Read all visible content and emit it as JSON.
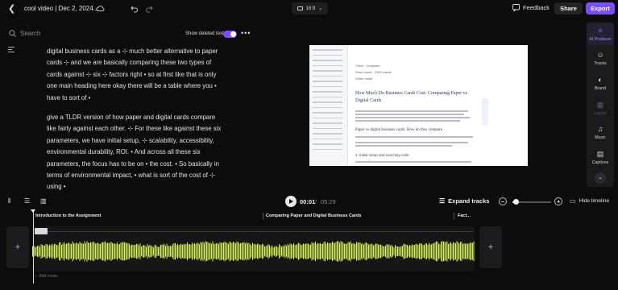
{
  "header": {
    "title": "cool video | Dec 2, 2024...",
    "aspect_ratio": "16:9",
    "feedback_label": "Feedback",
    "share_label": "Share",
    "export_label": "Export",
    "accent_color": "#7c4dff"
  },
  "transcript_panel": {
    "search_placeholder": "Search",
    "show_deleted_label": "Show deleted text",
    "show_deleted_on": true,
    "paragraphs": [
      "digital business cards as a ⊹ much better alternative to paper cards ⊹ and we are basically comparing these two types of cards against ⊹ six ⊹ factors right • so at first like that is only one main heading here okay there will be a table where you • have to sort of •",
      "give a TLDR version of how paper and digital cards compare like fairly against each other. ⊹ For these like against these six parameters, we have initial setup, ⊹ scalability, accessibility, environmental durability, ROI. • And across all these six parameters, the focus has to be on • the cost. • So basically in terms of environmental impact, • what is sort of the cost of ⊹ using •"
    ]
  },
  "preview": {
    "fields": [
      "Client - Unsplash",
      "Word count - 2000 words",
      "Writer email"
    ],
    "heading": "How Much Do Business Cards Cost: Comparing Paper vs Digital Cards",
    "subheading": "Paper vs digital business cards: How do they compare",
    "list_item": "1. Initial setup and sourcing costs"
  },
  "right_rail": {
    "items": [
      {
        "label": "AI Producer",
        "icon": "sparkle-icon"
      },
      {
        "label": "Tracks",
        "icon": "people-icon"
      },
      {
        "label": "Brand",
        "icon": "palette-icon"
      },
      {
        "label": "Layout",
        "icon": "layout-icon"
      },
      {
        "label": "Music",
        "icon": "music-icon"
      },
      {
        "label": "Captions",
        "icon": "captions-icon"
      }
    ]
  },
  "timeline": {
    "current_time": "00:01",
    "separator": "/",
    "total_time": "05:29",
    "expand_label": "Expand tracks",
    "hide_label": "Hide timeline",
    "zoom_level": 0.05,
    "chapters": [
      "Introduction to the Assignment",
      "Comparing Paper and Digital Business Cards",
      "Fact..."
    ],
    "add_music_label": "Add music",
    "waveform_color": "#d4f25a"
  }
}
